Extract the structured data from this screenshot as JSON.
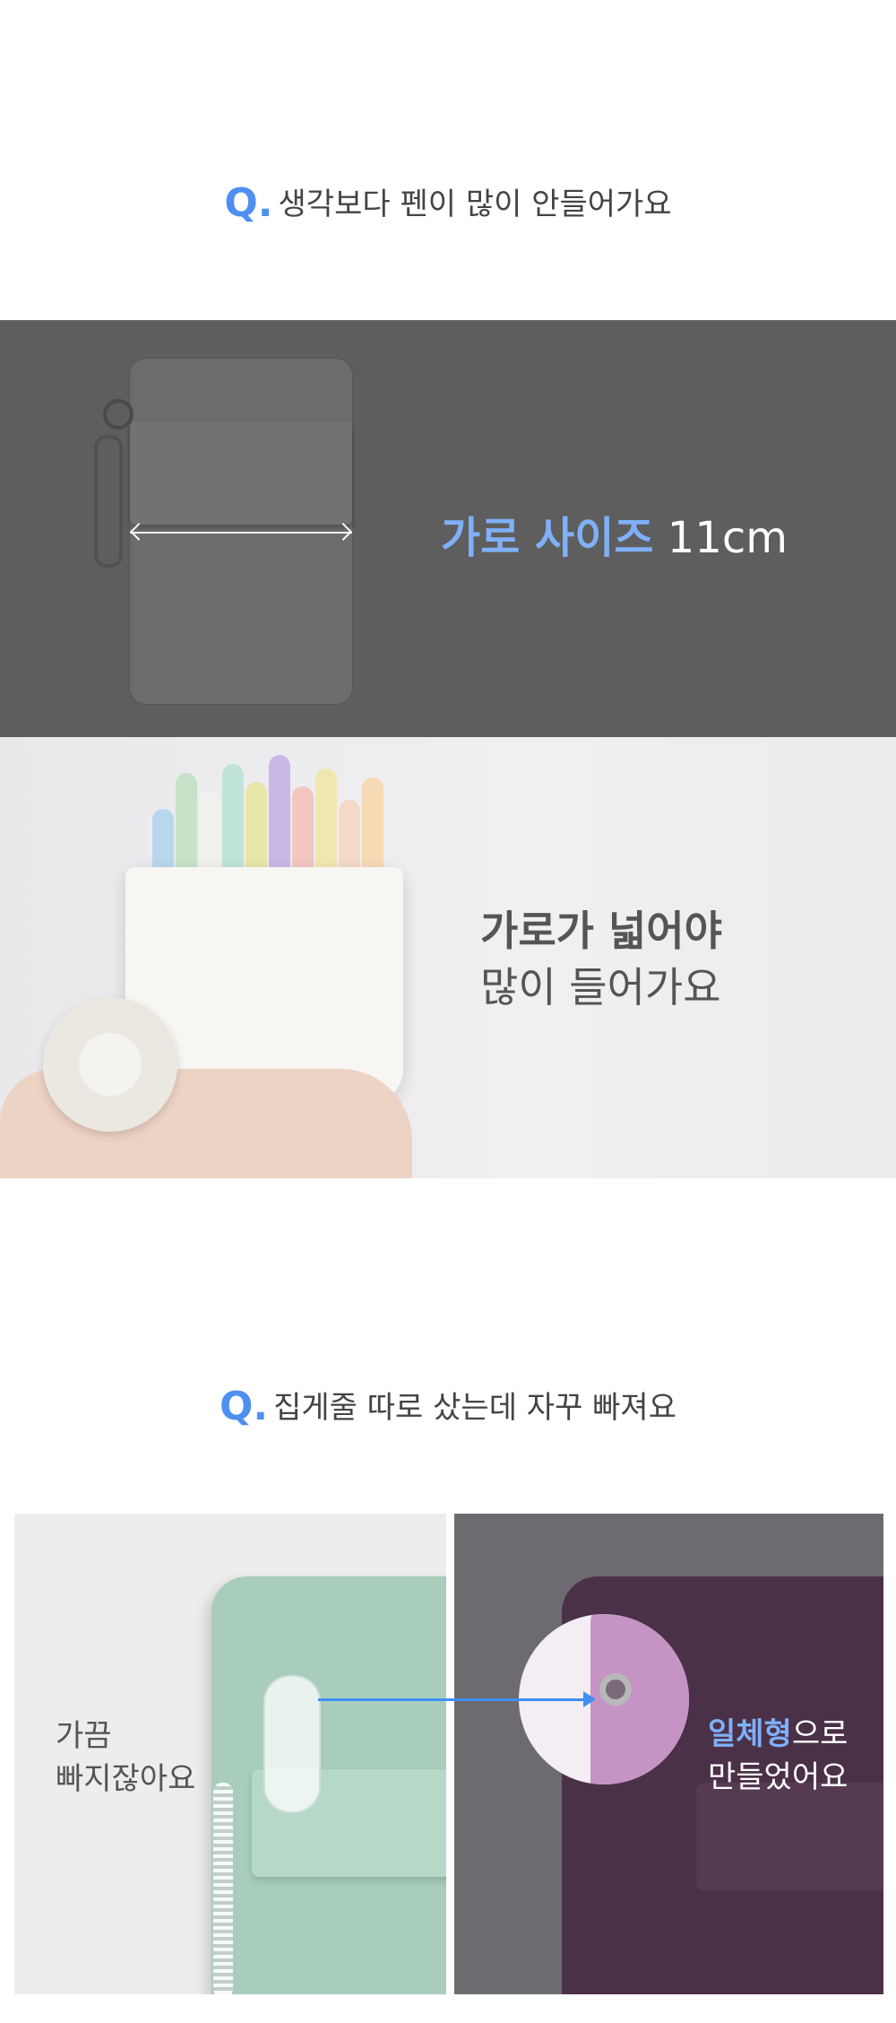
{
  "question1": {
    "marker": "Q.",
    "text": "생각보다 펜이 많이 안들어가요"
  },
  "width_section": {
    "label_accent": "가로 사이즈",
    "label_value": "11cm"
  },
  "capacity_section": {
    "title": "가로가 넓어야",
    "subtitle": "많이 들어가요"
  },
  "question2": {
    "marker": "Q.",
    "text": "집게줄 따로 샀는데 자꾸 빠져요"
  },
  "comparison": {
    "left_caption_line1": "가끔",
    "left_caption_line2": "빠지잖아요",
    "right_caption_accent": "일체형",
    "right_caption_suffix": "으로",
    "right_caption_line2": "만들었어요"
  },
  "colors": {
    "accent": "#4f8ff0",
    "mint": "#a9cdbb",
    "purple": "#4a3147",
    "dark_band": "#5e5e5e"
  },
  "icons": [
    "double-arrow-icon",
    "right-arrow-icon"
  ]
}
